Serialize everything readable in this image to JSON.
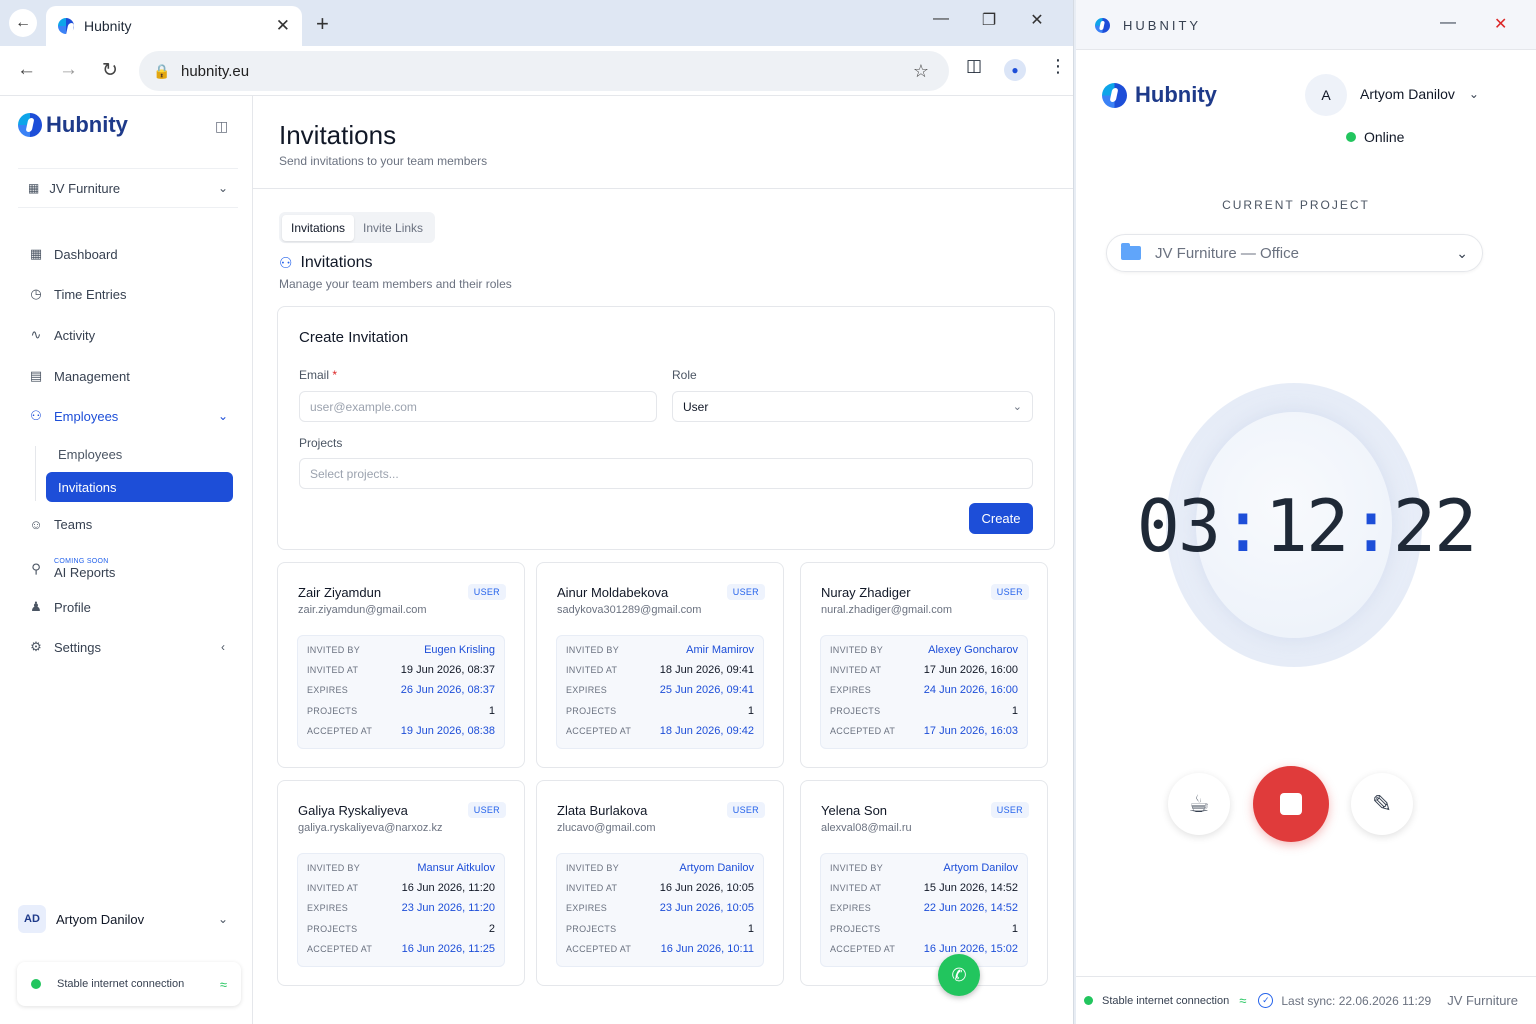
{
  "browser": {
    "tab_title": "Hubnity",
    "url": "hubnity.eu"
  },
  "sidebar": {
    "brand": "Hubnity",
    "org": "JV Furniture",
    "items": [
      {
        "label": "Dashboard",
        "icon": "grid-icon"
      },
      {
        "label": "Time Entries",
        "icon": "clock-icon"
      },
      {
        "label": "Activity",
        "icon": "pulse-icon"
      },
      {
        "label": "Management",
        "icon": "briefcase-icon"
      },
      {
        "label": "Employees",
        "icon": "users-icon"
      },
      {
        "label": "Teams",
        "icon": "team-icon"
      },
      {
        "label": "AI Reports",
        "icon": "lock-icon",
        "badge": "COMING SOON"
      },
      {
        "label": "Profile",
        "icon": "user-icon"
      },
      {
        "label": "Settings",
        "icon": "gear-icon"
      }
    ],
    "sub_items": [
      "Employees",
      "Invitations"
    ],
    "user": {
      "initials": "AD",
      "name": "Artyom Danilov"
    },
    "connection": "Stable internet connection"
  },
  "main": {
    "title": "Invitations",
    "subtitle": "Send invitations to your team members",
    "tabs": [
      "Invitations",
      "Invite Links"
    ],
    "section_title": "Invitations",
    "section_subtitle": "Manage your team members and their roles",
    "create": {
      "title": "Create Invitation",
      "email_label": "Email",
      "email_required": "*",
      "email_placeholder": "user@example.com",
      "role_label": "Role",
      "role_value": "User",
      "projects_label": "Projects",
      "projects_placeholder": "Select projects...",
      "button": "Create"
    },
    "field_labels": {
      "invited_by": "INVITED BY",
      "invited_at": "INVITED AT",
      "expires": "EXPIRES",
      "projects": "PROJECTS",
      "accepted_at": "ACCEPTED AT"
    },
    "invitations": [
      {
        "name": "Zair Ziyamdun",
        "email": "zair.ziyamdun@gmail.com",
        "role": "USER",
        "invited_by": "Eugen Krisling",
        "invited_at": "19 Jun 2026, 08:37",
        "expires": "26 Jun 2026, 08:37",
        "projects": "1",
        "accepted_at": "19 Jun 2026, 08:38"
      },
      {
        "name": "Ainur Moldabekova",
        "email": "sadykova301289@gmail.com",
        "role": "USER",
        "invited_by": "Amir Mamirov",
        "invited_at": "18 Jun 2026, 09:41",
        "expires": "25 Jun 2026, 09:41",
        "projects": "1",
        "accepted_at": "18 Jun 2026, 09:42"
      },
      {
        "name": "Nuray Zhadiger",
        "email": "nural.zhadiger@gmail.com",
        "role": "USER",
        "invited_by": "Alexey Goncharov",
        "invited_at": "17 Jun 2026, 16:00",
        "expires": "24 Jun 2026, 16:00",
        "projects": "1",
        "accepted_at": "17 Jun 2026, 16:03"
      },
      {
        "name": "Galiya Ryskaliyeva",
        "email": "galiya.ryskaliyeva@narxoz.kz",
        "role": "USER",
        "invited_by": "Mansur Aitkulov",
        "invited_at": "16 Jun 2026, 11:20",
        "expires": "23 Jun 2026, 11:20",
        "projects": "2",
        "accepted_at": "16 Jun 2026, 11:25"
      },
      {
        "name": "Zlata Burlakova",
        "email": "zlucavo@gmail.com",
        "role": "USER",
        "invited_by": "Artyom Danilov",
        "invited_at": "16 Jun 2026, 10:05",
        "expires": "23 Jun 2026, 10:05",
        "projects": "1",
        "accepted_at": "16 Jun 2026, 10:11"
      },
      {
        "name": "Yelena Son",
        "email": "alexval08@mail.ru",
        "role": "USER",
        "invited_by": "Artyom Danilov",
        "invited_at": "15 Jun 2026, 14:52",
        "expires": "22 Jun 2026, 14:52",
        "projects": "1",
        "accepted_at": "16 Jun 2026, 15:02"
      }
    ]
  },
  "tracker": {
    "window_title": "HUBNITY",
    "brand": "Hubnity",
    "avatar": "A",
    "user_name": "Artyom Danilov",
    "status": "Online",
    "current_project_label": "CURRENT PROJECT",
    "project": "JV Furniture — Office",
    "timer": {
      "h": "03",
      "m": "12",
      "s": "22"
    },
    "connection": "Stable internet connection",
    "last_sync": "Last sync: 22.06.2026 11:29",
    "footer_project": "JV Furniture"
  },
  "colors": {
    "accent": "#1d4ed8",
    "online": "#22c55e",
    "stop": "#e03b3b"
  }
}
